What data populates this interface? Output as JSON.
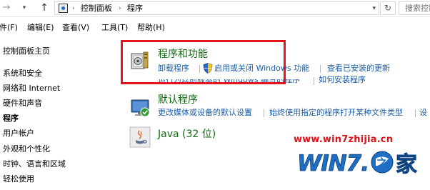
{
  "address_bar": {
    "breadcrumbs": [
      "控制面板",
      "程序"
    ],
    "search_placeholder": "搜索控制面板"
  },
  "menu": {
    "items": [
      "件(F)",
      "编辑(E)",
      "查看(V)",
      "工具(T)",
      "帮助(H)"
    ]
  },
  "sidebar": {
    "items": [
      {
        "label": "控制面板主页"
      },
      {
        "label": "系统和安全"
      },
      {
        "label": "网络和 Internet"
      },
      {
        "label": "硬件和声音"
      },
      {
        "label": "程序"
      },
      {
        "label": "用户帐户"
      },
      {
        "label": "外观和个性化"
      },
      {
        "label": "时钟、语言和区域"
      },
      {
        "label": "轻松使用"
      }
    ]
  },
  "sections": {
    "programs_features": {
      "title": "程序和功能",
      "tasks": [
        "卸载程序",
        "启用或关闭 Windows 功能",
        "查看已安装的更新",
        "运行为以前版本的 Windows 编写的程序",
        "如何安装程序"
      ]
    },
    "default_programs": {
      "title": "默认程序",
      "tasks": [
        "更改媒体或设备的默认设置",
        "始终使用指定的程序打开某种文件类型",
        "设"
      ]
    },
    "java": {
      "title": "Java (32 位)"
    }
  },
  "watermark": {
    "url": "www.win7zhijia.cn",
    "logo_text": "WIN7.之家"
  },
  "colors": {
    "section_title": "#0e6a0e",
    "task_link": "#1a5ba6",
    "highlight_box": "#e3161d",
    "watermark": "#d8141a",
    "logo_blue": "#1e6fc4"
  },
  "icons": {
    "programs_features": "programs-features-icon",
    "default_programs": "default-programs-icon",
    "java": "java-icon",
    "shield": "uac-shield-icon"
  }
}
